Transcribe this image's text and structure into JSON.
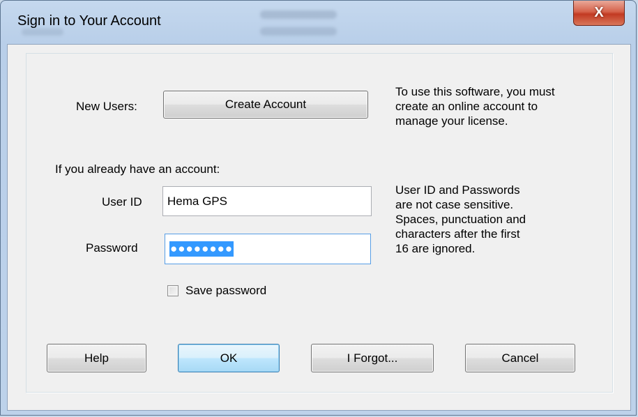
{
  "window": {
    "title": "Sign in to Your Account",
    "close_glyph": "X"
  },
  "new_users": {
    "label": "New Users:",
    "create_button": "Create Account",
    "info": "To use this software, you must\ncreate an online account to\nmanage your license."
  },
  "existing": {
    "heading": "If you already have an account:",
    "user_id_label": "User ID",
    "user_id_value": "Hema GPS",
    "password_label": "Password",
    "password_masked": "●●●●●●●●",
    "info": "User ID and Passwords\nare not case sensitive.\nSpaces, punctuation and\ncharacters after the first\n16 are ignored."
  },
  "save_password": {
    "label": "Save password",
    "checked": false
  },
  "buttons": {
    "help": "Help",
    "ok": "OK",
    "forgot": "I Forgot...",
    "cancel": "Cancel"
  },
  "colors": {
    "selection": "#3399ff",
    "close_red": "#c23a22",
    "default_button_border": "#3c7fb1"
  }
}
